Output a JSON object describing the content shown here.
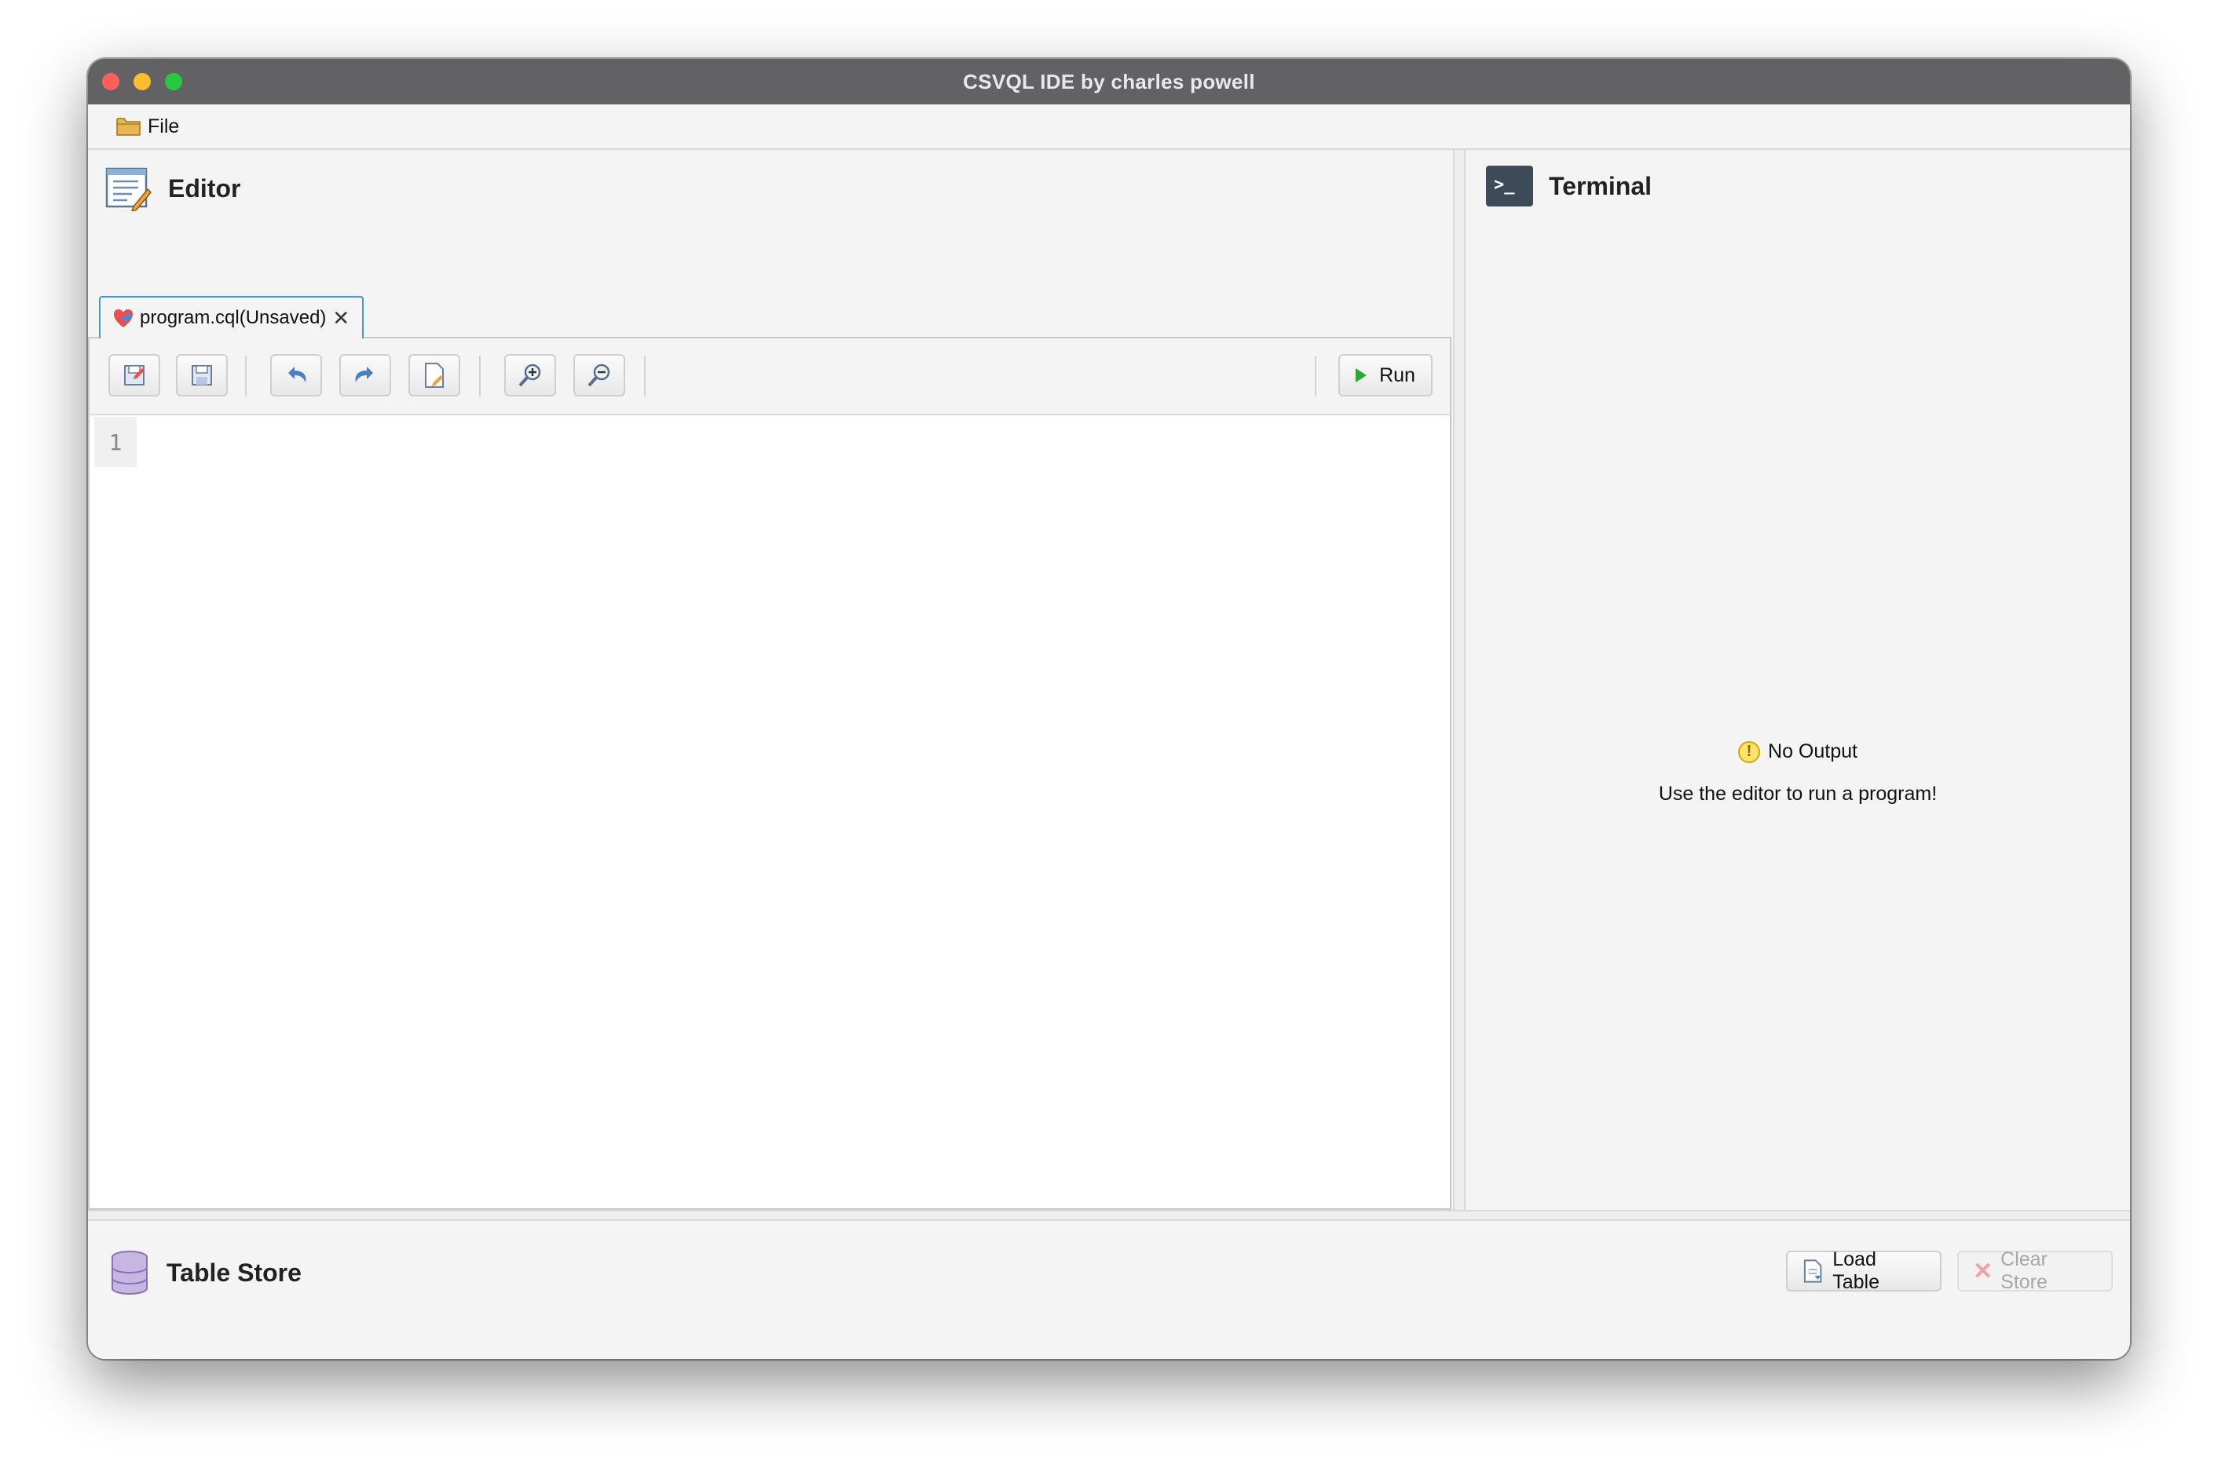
{
  "window": {
    "title": "CSVQL IDE by charles powell"
  },
  "menu": {
    "file_label": "File"
  },
  "editor": {
    "title": "Editor",
    "tab_label": "program.cql(Unsaved)",
    "tab_close": "✕",
    "run_label": "Run",
    "line_number": "1",
    "toolbar_icons": [
      "save-as-icon",
      "save-icon",
      "undo-icon",
      "redo-icon",
      "edit-file-icon",
      "zoom-in-icon",
      "zoom-out-icon"
    ]
  },
  "terminal": {
    "title": "Terminal",
    "no_output": "No Output",
    "hint": "Use the editor to run a program!"
  },
  "table_store": {
    "title": "Table Store",
    "load_label": "Load Table",
    "clear_label": "Clear Store"
  },
  "colors": {
    "titlebar": "#626164",
    "tab_border": "#3b9ae0",
    "run_icon": "#2aa830",
    "warning": "#ffe36a",
    "db_icon": "#a48ec8"
  }
}
